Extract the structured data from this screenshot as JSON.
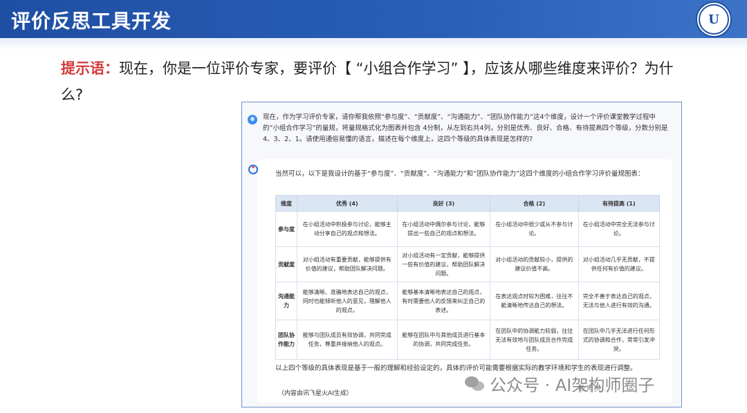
{
  "header": {
    "title": "评价反思工具开发",
    "logo_text": "U"
  },
  "prompt": {
    "label": "提示语：",
    "text": "现在，你是一位评价专家，要评价【 “小组合作学习” 】，应该从哪些维度来评价？为什么?"
  },
  "chat": {
    "question": "现在，作为学习评价专家，请你帮我依照“参与度”、“贡献度”、“沟通能力”、“团队协作能力”这4个维度，设计一个评价课堂教学过程中的“小组合作学习”的量规，将量规格式化为图表并包含 4分制，从左到右共4列，分别是优秀、良好、合格、有待提高四个等级，分数分别是4、3、2、1。请使用通俗易懂的语言，描述在每个维度上，这四个等级的具体表现是怎样的?",
    "answer_intro": "当然可以，以下是我设计的基于“参与度”、“贡献度”、“沟通能力”和“团队协作能力”这四个维度的小组合作学习评价量规图表：",
    "table": {
      "headers": [
        "维度",
        "优秀 (4)",
        "良好 (3)",
        "合格 (2)",
        "有待提高 (1)"
      ],
      "rows": [
        [
          "参与度",
          "在小组活动中积极参与讨论，能够主动分享自己的观点和想法。",
          "在小组活动中偶尔参与讨论，能够提出一些自己的观点和想法。",
          "在小组活动中很少或从不参与讨论。",
          "在小组活动中完全无法参与讨论。"
        ],
        [
          "贡献度",
          "对小组活动有重要贡献，能够提供有价值的建议，帮助团队解决问题。",
          "对小组活动有一定贡献，能够提供一些有价值的建议，帮助团队解决问题。",
          "对小组活动的贡献较小，提供的建议价值不高。",
          "对小组活动几乎无贡献，不提供任何有价值的建议。"
        ],
        [
          "沟通能力",
          "能够清晰、准确地表达自己的观点，同时也能倾听他人的意见，理解他人的观点。",
          "能够基本清晰地表达自己的观点，有时需要他人的反馈来纠正自己的表述。",
          "在表达观点时较为困难，往往不能清晰地传达自己的想法。",
          "完全不善于表达自己的观点，无法与他人进行有效的沟通。"
        ],
        [
          "团队协作能力",
          "能够与团队成员有效协调，共同完成任务，尊重并接纳他人的观点。",
          "能够在团队中与其他成员进行基本的协调，共同完成任务。",
          "在团队中的协调能力较弱，往往无法有效地与团队成员合作完成任务。",
          "在团队中几乎无法进行任何形式的协调和合作，常常引发冲突。"
        ]
      ]
    },
    "answer_conclusion": "以上四个等级的具体表现是基于一般的理解和经验设定的，具体的评价可能需要根据实际的教学环境和学生的表现进行调整。",
    "note": "（内容由讯飞星火AI生成）"
  },
  "watermark": {
    "text": "公众号 · AI架构师圈子",
    "small": "教育执…"
  }
}
